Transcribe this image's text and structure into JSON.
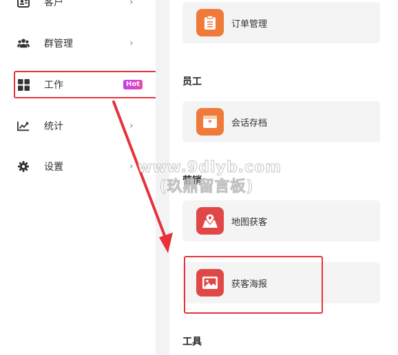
{
  "sidebar": {
    "items": [
      {
        "label": "客户",
        "icon": "contact-card-icon"
      },
      {
        "label": "群管理",
        "icon": "group-icon"
      },
      {
        "label": "工作",
        "icon": "grid-icon",
        "badge": "Hot"
      },
      {
        "label": "统计",
        "icon": "trend-chart-icon"
      },
      {
        "label": "设置",
        "icon": "gear-icon"
      }
    ],
    "chevron": "›"
  },
  "main": {
    "top_card": {
      "label": "订单管理",
      "icon": "clipboard-icon",
      "color": "#ef7a3a"
    },
    "sections": [
      {
        "title": "员工",
        "cards": [
          {
            "label": "会话存档",
            "icon": "archive-box-icon",
            "color": "#ef7a3a"
          }
        ]
      },
      {
        "title": "营销",
        "cards": [
          {
            "label": "地图获客",
            "icon": "map-pin-icon",
            "color": "#e04848"
          },
          {
            "label": "获客海报",
            "icon": "image-poster-icon",
            "color": "#e04848"
          }
        ]
      },
      {
        "title": "工具",
        "cards": []
      }
    ]
  },
  "watermark": {
    "line1": "www.9dlyb.com",
    "line2": "(玖鼎留言板)"
  },
  "colors": {
    "annotation_red": "#e8313a",
    "hot_badge": "#d040d8",
    "panel_bg": "#f2f3f5"
  }
}
